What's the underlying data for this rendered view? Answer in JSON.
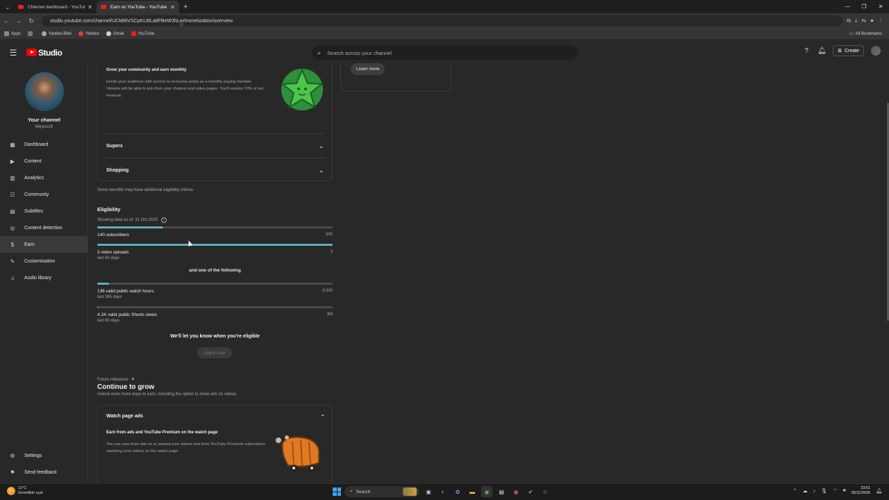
{
  "browser": {
    "tabs": [
      {
        "title": "Channel dashboard - YouTube",
        "active": false
      },
      {
        "title": "Earn on YouTube - YouTube St",
        "active": true
      }
    ],
    "url": "studio.youtube.com/channel/UCkB6VSCpKL6tLa8FBeW3hLw/monetization/overview",
    "bookmarks": [
      "Apps",
      "Yandex.Bilet",
      "Yandex",
      "Gmail",
      "YouTube"
    ],
    "all_bookmarks": "All Bookmarks"
  },
  "header": {
    "logo_text": "Studio",
    "search_placeholder": "Search across your channel",
    "create_label": "Create"
  },
  "sidebar": {
    "channel_title": "Your channel",
    "channel_handle": "WeyssUK",
    "items": [
      {
        "label": "Dashboard",
        "icon": "dashboard-icon"
      },
      {
        "label": "Content",
        "icon": "content-icon"
      },
      {
        "label": "Analytics",
        "icon": "analytics-icon"
      },
      {
        "label": "Community",
        "icon": "community-icon"
      },
      {
        "label": "Subtitles",
        "icon": "subtitles-icon"
      },
      {
        "label": "Content detection",
        "icon": "content-detection-icon"
      },
      {
        "label": "Earn",
        "icon": "earn-icon"
      },
      {
        "label": "Customisation",
        "icon": "customisation-icon"
      },
      {
        "label": "Audio library",
        "icon": "audio-library-icon"
      }
    ],
    "bottom_items": [
      {
        "label": "Settings",
        "icon": "settings-icon"
      },
      {
        "label": "Send feedback",
        "icon": "feedback-icon"
      }
    ]
  },
  "membership": {
    "heading": "Grow your community and earn monthly",
    "body": "Excite your audience with access to exclusive perks as a monthly paying member. Viewers will be able to join from your channel and video pages. You'll receive 70% of net revenue.",
    "accordions": [
      "Supers",
      "Shopping"
    ]
  },
  "learn_more": "Learn more",
  "note": "Some benefits may have additional eligibility criteria.",
  "eligibility": {
    "title": "Eligibility",
    "date": "Showing data as of: 31 Oct 2025",
    "metrics": [
      {
        "label": "140 subscribers",
        "goal": "500",
        "sub": "",
        "progress": 0.28
      },
      {
        "label": "3 video uploads",
        "goal": "3",
        "sub": "last 90 days",
        "progress": 1.0
      },
      {
        "label": "136 valid public watch hours",
        "goal": "3,000",
        "sub": "last 365 days",
        "progress": 0.05
      },
      {
        "label": "4.1K valid public Shorts views",
        "goal": "3M",
        "sub": "last 90 days",
        "progress": 0.0014
      }
    ],
    "and_one": "and one of the following",
    "notify": "We'll let you know when you're eligible",
    "apply": "Apply now"
  },
  "future": {
    "label": "Future milestone",
    "title": "Continue to grow",
    "desc": "Unlock even more ways to earn, including the option to show ads on videos."
  },
  "ads": {
    "title": "Watch page ads",
    "subtitle": "Earn from ads and YouTube Premium on the watch page",
    "body": "You can earn from ads on or around your videos and from YouTube Premium subscribers watching your videos on the watch page"
  },
  "taskbar": {
    "weather_temp": "12°C",
    "weather_desc": "Genellikle açık",
    "search": "Search",
    "time": "23:51",
    "date": "05/11/2025"
  },
  "colors": {
    "accent": "#5eaec2",
    "youtube_red": "#ff0000",
    "background": "#282828"
  }
}
